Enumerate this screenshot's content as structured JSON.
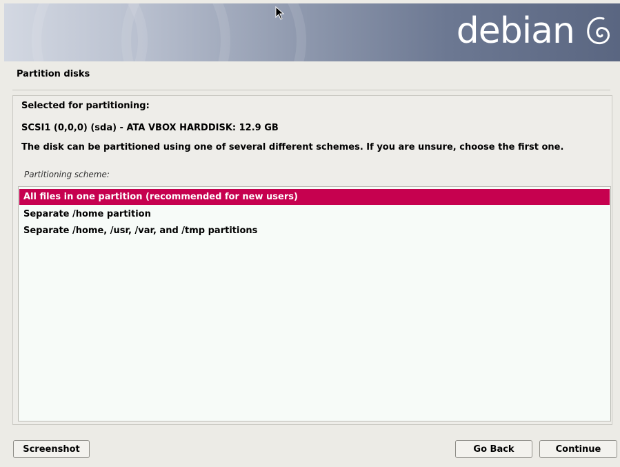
{
  "banner": {
    "logo_text": "debian",
    "logo_icon": "debian-swirl-icon",
    "gradient_colors": [
      "#d3d8e2",
      "#8f99ae",
      "#5a6681"
    ]
  },
  "page": {
    "title": "Partition disks"
  },
  "info": {
    "selected_label": "Selected for partitioning:",
    "disk": "SCSI1 (0,0,0) (sda) - ATA VBOX HARDDISK: 12.9 GB",
    "description": "The disk can be partitioned using one of several different schemes. If you are unsure, choose the first one."
  },
  "scheme": {
    "label": "Partitioning scheme:",
    "options": [
      {
        "label": "All files in one partition (recommended for new users)",
        "selected": true
      },
      {
        "label": "Separate /home partition",
        "selected": false
      },
      {
        "label": "Separate /home, /usr, /var, and /tmp partitions",
        "selected": false
      }
    ]
  },
  "buttons": {
    "screenshot": "Screenshot",
    "go_back": "Go Back",
    "continue": "Continue"
  },
  "colors": {
    "selection": "#c6014f",
    "background": "#ecebe6",
    "list_background": "#f7fbf8"
  }
}
